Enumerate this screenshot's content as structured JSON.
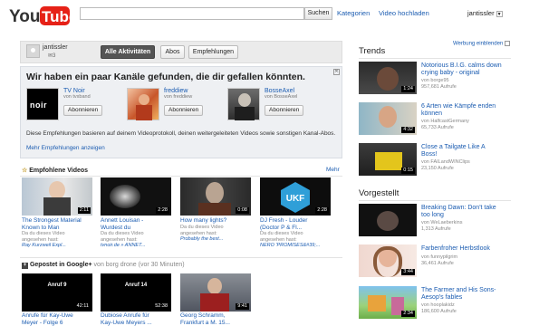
{
  "header": {
    "logo_you": "You",
    "logo_tube": "Tube",
    "search_placeholder": "",
    "search_button": "Suchen",
    "categories": "Kategorien",
    "upload": "Video hochladen",
    "username": "jantissler"
  },
  "feed": {
    "username": "jantissler",
    "count": "3",
    "buttons": [
      "Alle Aktivitäten",
      "Abos",
      "Empfehlungen"
    ]
  },
  "recommendations": {
    "title": "Wir haben ein paar Kanäle gefunden, die dir gefallen könnten.",
    "channels": [
      {
        "name": "TV Noir",
        "sub": "von tvxband",
        "thumb_text": "noir",
        "button": "Abonnieren"
      },
      {
        "name": "freddiew",
        "sub": "von freddiew",
        "button": "Abonnieren"
      },
      {
        "name": "BosseAxel",
        "sub": "von BosseAxel",
        "button": "Abonnieren"
      }
    ],
    "description": "Diese Empfehlungen basieren auf deinem Videoprotokoll, deinen weitergeleiteten Videos sowie sonstigen Kanal-Abos.",
    "more_link": "Mehr Empfehlungen anzeigen"
  },
  "recommended_videos": {
    "heading": "Empfohlene Videos",
    "more": "Mehr",
    "items": [
      {
        "title1": "The Strongest Material",
        "title2": "Known to Man",
        "duration": "2:11",
        "meta1": "Da du dieses Video",
        "meta2": "angesehen hast:",
        "link": "Ray Kurzweil Expl..."
      },
      {
        "title1": "Annett Louisan -",
        "title2": "Wurdest du",
        "duration": "2:28",
        "meta1": "Da du dieses Video",
        "meta2": "angesehen hast:",
        "link": "tvnoir.de » ANNET..."
      },
      {
        "title1": "How many lights?",
        "title2": "",
        "duration": "0:08",
        "meta1": "Da du dieses Video",
        "meta2": "angesehen hast:",
        "link": "Probably the best..."
      },
      {
        "title1": "DJ Fresh - Louder",
        "title2": "(Doctor P & Fl...",
        "duration": "2:28",
        "meta1": "Da du dieses Video",
        "meta2": "angesehen hast:",
        "link": "NERO 'PROMISES&#39;..."
      }
    ]
  },
  "google_plus": {
    "heading": "Gepostet in Google+",
    "heading_suffix": " von borg drone",
    "time": "vor 30 Minuten",
    "items": [
      {
        "thumb_text": "Anruf 9",
        "duration": "42:11",
        "title1": "Anrufe für Kay-Uwe",
        "title2": "Meyer - Folge 6"
      },
      {
        "thumb_text": "Anruf 14",
        "duration": "52:38",
        "title1": "Dubiose Anrufe für",
        "title2": "Kay-Uwe Meyers ..."
      },
      {
        "thumb_text": "",
        "duration": "9:41",
        "title1": "Georg Schramm,",
        "title2": "Frankfurt a M. 15..."
      }
    ]
  },
  "trends": {
    "heading": "Trends",
    "ad_toggle": "Werbung einblenden",
    "items": [
      {
        "title1": "Notorious B.I.G. calms down",
        "title2": "crying baby - original",
        "by": "von borge95",
        "views": "957,681 Aufrufe",
        "duration": "1:24"
      },
      {
        "title1": "6 Arten wie Kämpfe enden",
        "title2": "können",
        "by": "von HalfcastGermany",
        "views": "65,733 Aufrufe",
        "duration": "4:32"
      },
      {
        "title1": "Close a Tailgate Like A",
        "title2": "Boss!",
        "by": "von FAILandWINClips",
        "views": "23,150 Aufrufe",
        "duration": "0:15"
      }
    ]
  },
  "featured": {
    "heading": "Vorgestellt",
    "items": [
      {
        "title1": "Breaking Dawn: Don't take",
        "title2": "too long",
        "by": "von WeLaeberkins",
        "views": "1,313 Aufrufe",
        "duration": ""
      },
      {
        "title1": "Farbenfroher Herbstlook",
        "title2": "",
        "by": "von funnypilgrim",
        "views": "36,461 Aufrufe",
        "duration": "3:44"
      },
      {
        "title1": "The Farmer and His Sons-",
        "title2": "Aesop's fables",
        "by": "von hooplakidz",
        "views": "186,600 Aufrufe",
        "duration": "2:34"
      }
    ]
  }
}
